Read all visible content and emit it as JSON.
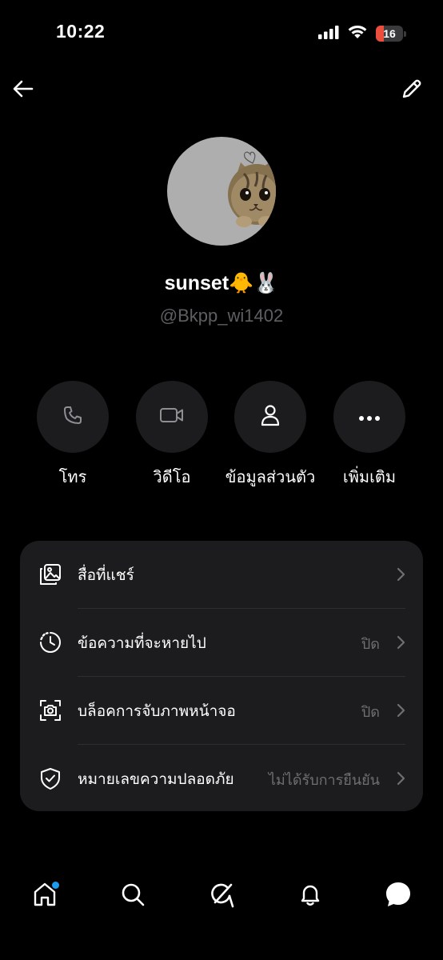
{
  "status_bar": {
    "time": "10:22",
    "battery": "16"
  },
  "profile": {
    "display_name": "sunset🐥🐰",
    "username": "@Bkpp_wi1402"
  },
  "actions": [
    {
      "label": "โทร",
      "icon": "phone-icon"
    },
    {
      "label": "วิดีโอ",
      "icon": "video-icon"
    },
    {
      "label": "ข้อมูลส่วนตัว",
      "icon": "person-icon"
    },
    {
      "label": "เพิ่มเติม",
      "icon": "more-icon"
    }
  ],
  "settings": [
    {
      "label": "สื่อที่แชร์",
      "value": "",
      "icon": "media-icon"
    },
    {
      "label": "ข้อความที่จะหายไป",
      "value": "ปิด",
      "icon": "timer-icon"
    },
    {
      "label": "บล็อคการจับภาพหน้าจอ",
      "value": "ปิด",
      "icon": "screenshot-icon"
    },
    {
      "label": "หมายเลขความปลอดภัย",
      "value": "ไม่ได้รับการยืนยัน",
      "icon": "shield-icon"
    }
  ],
  "tabs": [
    "home",
    "search",
    "grok",
    "notifications",
    "messages"
  ],
  "colors": {
    "background": "#000000",
    "card": "#1c1c1e",
    "muted_text": "#6e6e73",
    "badge_dot": "#1d9bf0",
    "battery_low": "#eb4e3d"
  }
}
